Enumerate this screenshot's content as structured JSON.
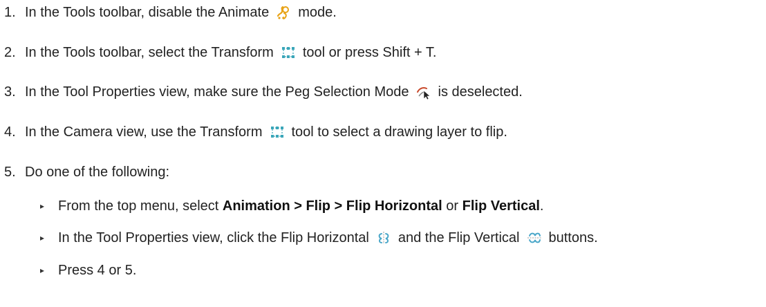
{
  "steps": [
    {
      "num": "1.",
      "a": "In the Tools toolbar, disable the Animate",
      "icon": "animate-icon",
      "b": "mode."
    },
    {
      "num": "2.",
      "a": "In the Tools toolbar, select the Transform",
      "icon": "transform-icon",
      "b": "tool or press Shift + T."
    },
    {
      "num": "3.",
      "a": "In the Tool Properties view, make sure the Peg Selection Mode",
      "icon": "peg-selection-icon",
      "b": "is deselected."
    },
    {
      "num": "4.",
      "a": "In the Camera view, use the Transform",
      "icon": "transform-icon",
      "b": "tool to select a drawing layer to flip."
    },
    {
      "num": "5.",
      "a": "Do one of the following:"
    }
  ],
  "substeps": [
    {
      "bullet": "▸",
      "a": "From the top menu, select",
      "b1": "Animation > Flip > Flip Horizontal",
      "mid": "or",
      "b2": "Flip Vertical",
      "end": "."
    },
    {
      "bullet": "▸",
      "a": "In the Tool Properties view, click the Flip Horizontal",
      "icon1": "flip-horizontal-icon",
      "mid": "and the Flip Vertical",
      "icon2": "flip-vertical-icon",
      "end": "buttons."
    },
    {
      "bullet": "▸",
      "a": "Press 4 or 5."
    }
  ],
  "colors": {
    "animate": "#e8a317",
    "transform": "#3aa6b9",
    "flip": "#4aa7c9"
  }
}
